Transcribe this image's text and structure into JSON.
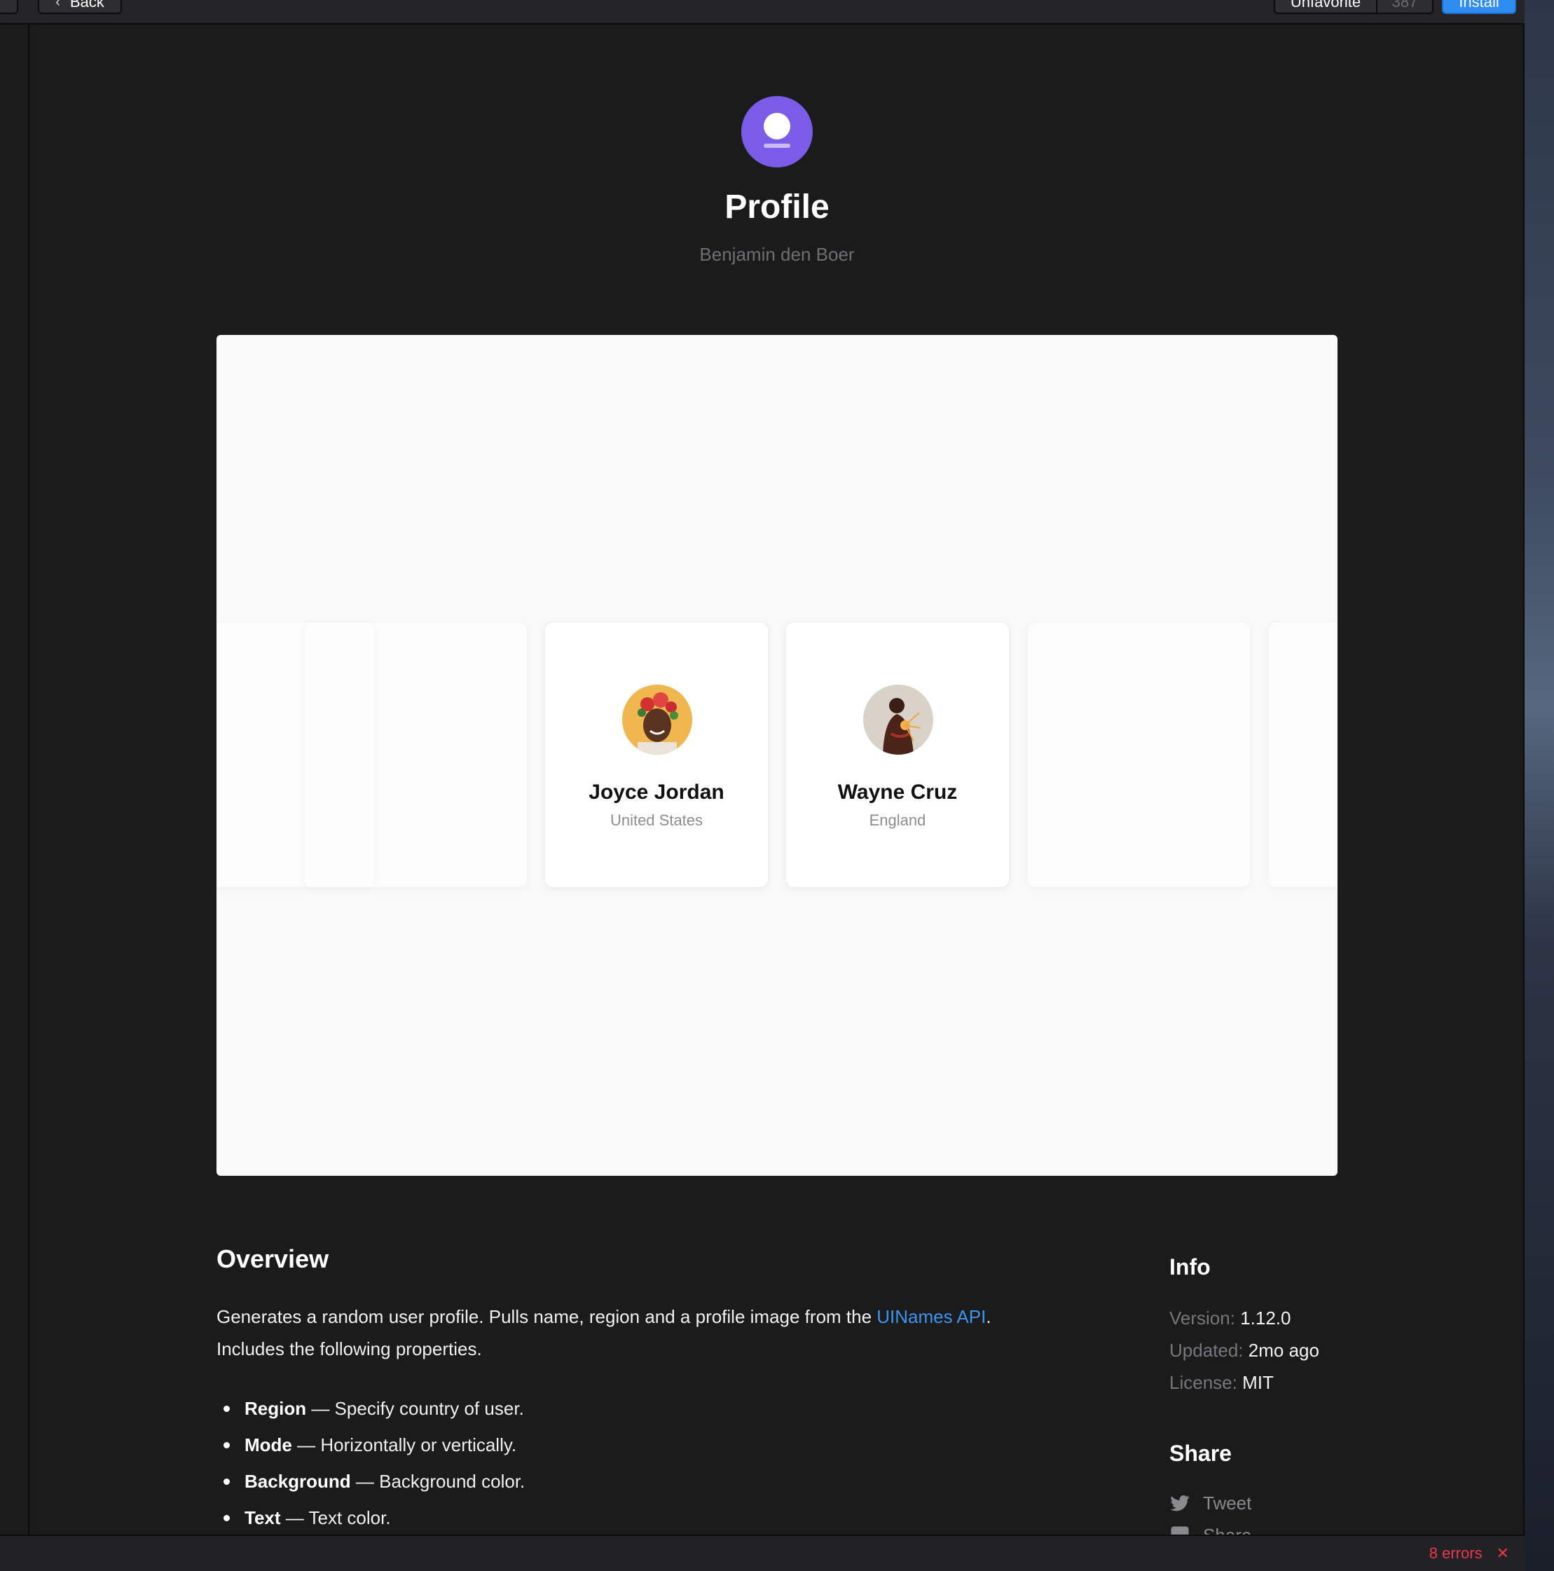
{
  "toolbar": {
    "back_label": "Back",
    "unfavorite_label": "Unfavorite",
    "favorite_count": "387",
    "install_label": "Install"
  },
  "header": {
    "title": "Profile",
    "author": "Benjamin den Boer"
  },
  "preview": {
    "cards": [
      {
        "name": "Joyce Jordan",
        "region": "United States"
      },
      {
        "name": "Wayne Cruz",
        "region": "England"
      }
    ]
  },
  "overview": {
    "title": "Overview",
    "text_before_link": "Generates a random user profile. Pulls name, region and a profile image from the ",
    "link_text": "UINames API",
    "text_after_link": ".",
    "text_line2": "Includes the following properties.",
    "properties": [
      {
        "name": "Region",
        "desc": " — Specify country of user."
      },
      {
        "name": "Mode",
        "desc": " — Horizontally or vertically."
      },
      {
        "name": "Background",
        "desc": " — Background color."
      },
      {
        "name": "Text",
        "desc": " — Text color."
      }
    ]
  },
  "info": {
    "title": "Info",
    "version_key": "Version:",
    "version_val": "1.12.0",
    "updated_key": "Updated:",
    "updated_val": "2mo ago",
    "license_key": "License:",
    "license_val": "MIT"
  },
  "share": {
    "title": "Share",
    "tweet_label": "Tweet",
    "share_label": "Share"
  },
  "status": {
    "errors_label": "8 errors"
  },
  "colors": {
    "accent": "#2f8cf0",
    "app_icon": "#7b5ce8",
    "error": "#e8384f",
    "link": "#3d95f0"
  }
}
